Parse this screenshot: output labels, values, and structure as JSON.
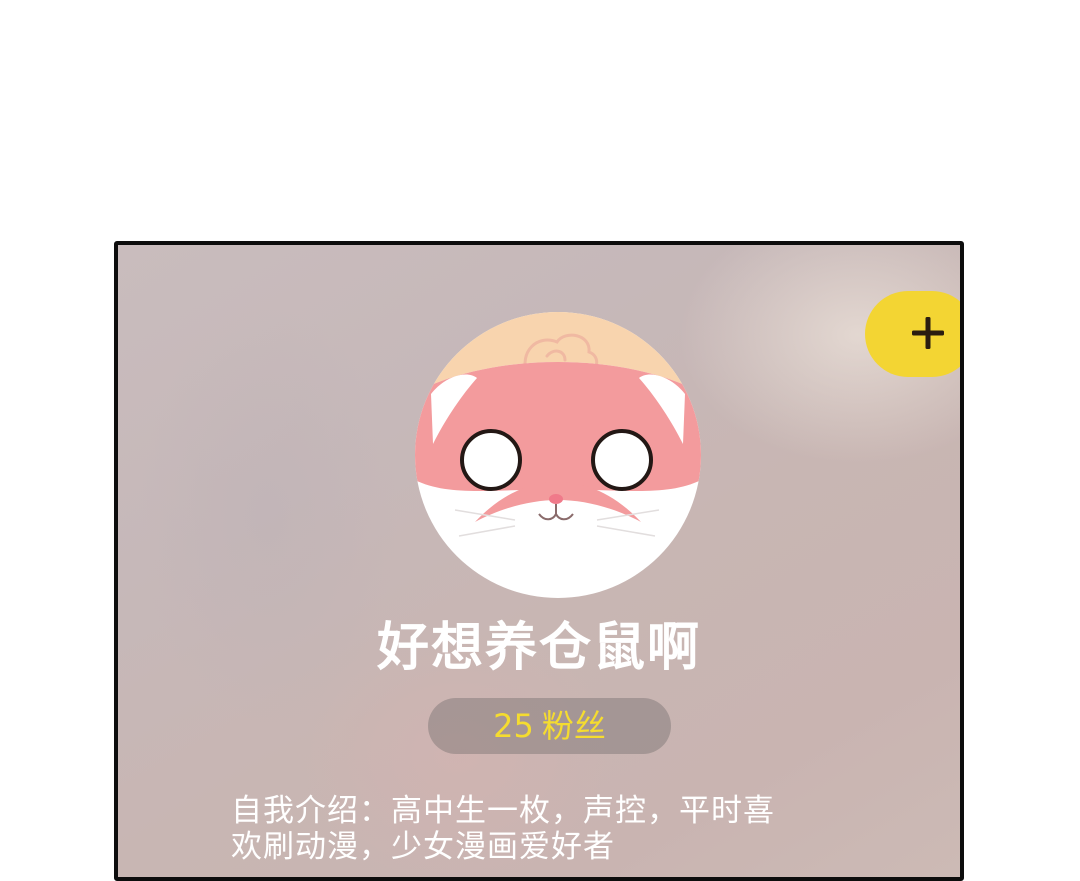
{
  "profile": {
    "nickname": "好想养仓鼠啊",
    "fans_count": "25",
    "fans_label": "粉丝",
    "bio_lines": [
      "自我介绍：高中生一枚，声控，平时喜",
      "欢刷动漫，少女漫画爱好者"
    ]
  },
  "follow_button": {
    "icon": "plus-icon",
    "color": "#f3d533"
  },
  "avatar": {
    "icon": "hamster-icon",
    "colors": {
      "face": "#f39b9d",
      "top": "#f8d4ae",
      "bottom": "#ffffff"
    }
  },
  "colors": {
    "fans_text": "#f5dc2f",
    "text": "#ffffff"
  }
}
